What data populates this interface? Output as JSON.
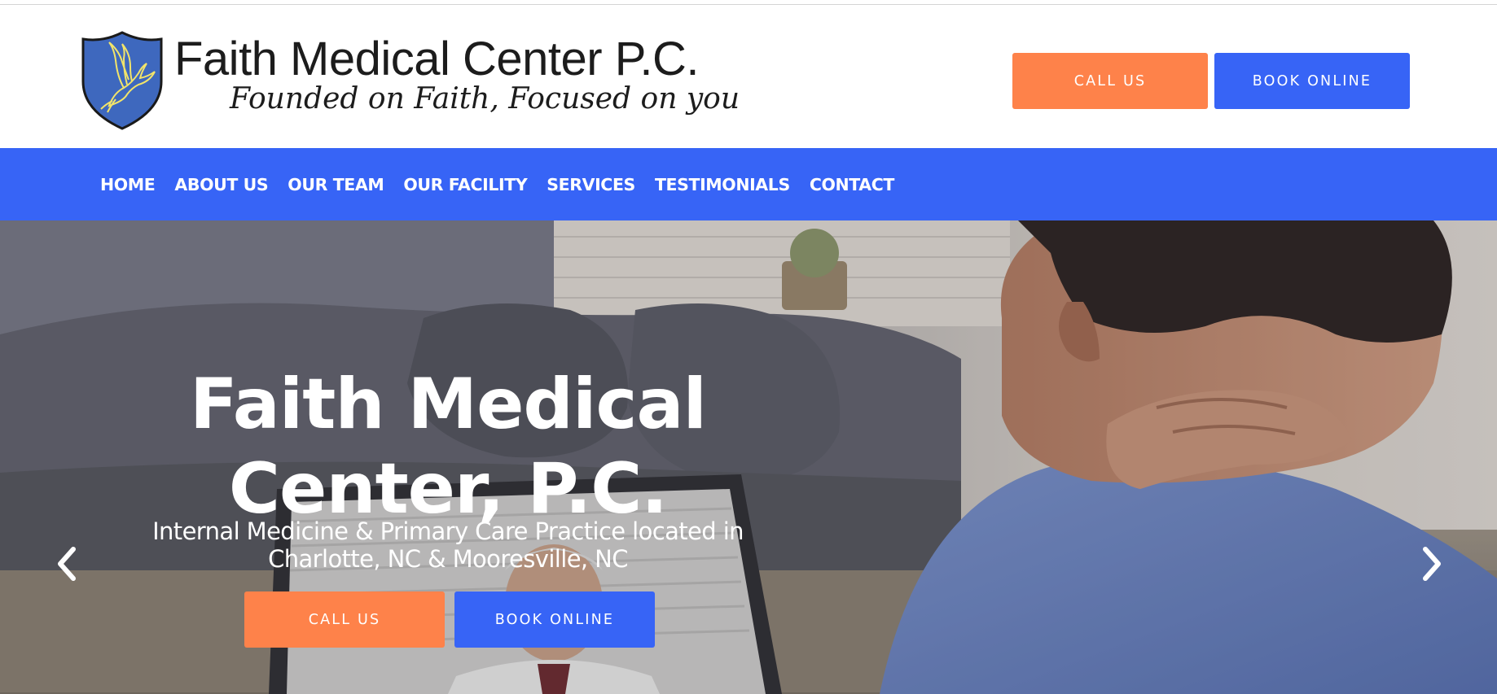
{
  "header": {
    "logo": {
      "title": "Faith Medical Center P.C.",
      "tagline": "Founded on Faith, Focused on you",
      "icon": "dove-shield-icon"
    },
    "call_label": "CALL US",
    "book_label": "BOOK ONLINE"
  },
  "nav": {
    "items": [
      {
        "label": "HOME"
      },
      {
        "label": "ABOUT US"
      },
      {
        "label": "OUR TEAM"
      },
      {
        "label": "OUR FACILITY"
      },
      {
        "label": "SERVICES"
      },
      {
        "label": "TESTIMONIALS"
      },
      {
        "label": "CONTACT"
      }
    ]
  },
  "hero": {
    "title": "Faith Medical Center, P.C.",
    "subtitle": "Internal Medicine & Primary Care Practice located in Charlotte, NC & Mooresville, NC",
    "call_label": "CALL US",
    "book_label": "BOOK ONLINE",
    "prev_icon": "chevron-left-icon",
    "next_icon": "chevron-right-icon"
  },
  "colors": {
    "nav_blue": "#3764f6",
    "accent_orange": "#fe824a",
    "shield_blue": "#3e68be",
    "dove_yellow": "#f2e46a",
    "text_dark": "#1c1c1c"
  }
}
